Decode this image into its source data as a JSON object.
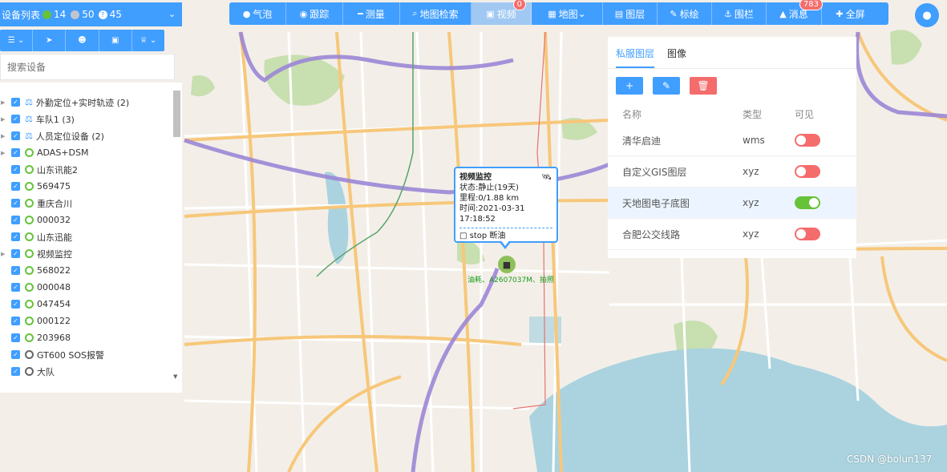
{
  "toolbar": {
    "items": [
      {
        "icon": "chat-bubble-icon",
        "label": "气泡"
      },
      {
        "icon": "eye-icon",
        "label": "跟踪"
      },
      {
        "icon": "ruler-icon",
        "label": "测量"
      },
      {
        "icon": "search-icon",
        "label": "地图检索"
      },
      {
        "icon": "video-icon",
        "label": "视频",
        "badge": "0"
      },
      {
        "icon": "map-icon",
        "label": "地图"
      },
      {
        "icon": "layers-icon",
        "label": "图层"
      },
      {
        "icon": "brush-icon",
        "label": "标绘"
      },
      {
        "icon": "anchor-icon",
        "label": "围栏"
      },
      {
        "icon": "bell-icon",
        "label": "消息",
        "badge": "783"
      },
      {
        "icon": "move-icon",
        "label": "全屏"
      }
    ]
  },
  "device_panel": {
    "title": "设备列表",
    "online_count": "14",
    "offline_count": "50",
    "unknown_count": "45",
    "search_placeholder": "搜索设备",
    "tree": [
      {
        "label": "外勤定位+实时轨迹 (2)",
        "type": "group"
      },
      {
        "label": "车队1 (3)",
        "type": "group"
      },
      {
        "label": "人员定位设备 (2)",
        "type": "group"
      },
      {
        "label": "ADAS+DSM",
        "type": "online",
        "caret": true
      },
      {
        "label": "山东讯能2",
        "type": "online"
      },
      {
        "label": "569475",
        "type": "online"
      },
      {
        "label": "重庆合川",
        "type": "online"
      },
      {
        "label": "000032",
        "type": "online"
      },
      {
        "label": "山东迅能",
        "type": "online"
      },
      {
        "label": "视频监控",
        "type": "online",
        "caret": true
      },
      {
        "label": "568022",
        "type": "online"
      },
      {
        "label": "000048",
        "type": "online"
      },
      {
        "label": "047454",
        "type": "online"
      },
      {
        "label": "000122",
        "type": "online"
      },
      {
        "label": "203968",
        "type": "online"
      },
      {
        "label": "GT600 SOS报警",
        "type": "offline"
      },
      {
        "label": "大队",
        "type": "offline"
      }
    ]
  },
  "layer_panel": {
    "tabs": [
      "私服图层",
      "图像"
    ],
    "columns": {
      "name": "名称",
      "type": "类型",
      "visible": "可见"
    },
    "rows": [
      {
        "name": "清华启迪",
        "type": "wms",
        "visible": false
      },
      {
        "name": "自定义GIS图层",
        "type": "xyz",
        "visible": false
      },
      {
        "name": "天地图电子底图",
        "type": "xyz",
        "visible": true
      },
      {
        "name": "合肥公交线路",
        "type": "xyz",
        "visible": false
      }
    ]
  },
  "popup": {
    "title": "视频监控",
    "status": "状态:静止(19天)",
    "mileage": "里程:0/1.88 km",
    "time": "时间:2021-03-31 17:18:52",
    "actions": "stop 断油"
  },
  "vehicle_label": "油耗、A2607037M、拍照",
  "watermark": "CSDN @bolun137",
  "colors": {
    "primary": "#409eff",
    "danger": "#f56c6c",
    "success": "#67c23a",
    "active_tab": "#a0c8f2"
  }
}
